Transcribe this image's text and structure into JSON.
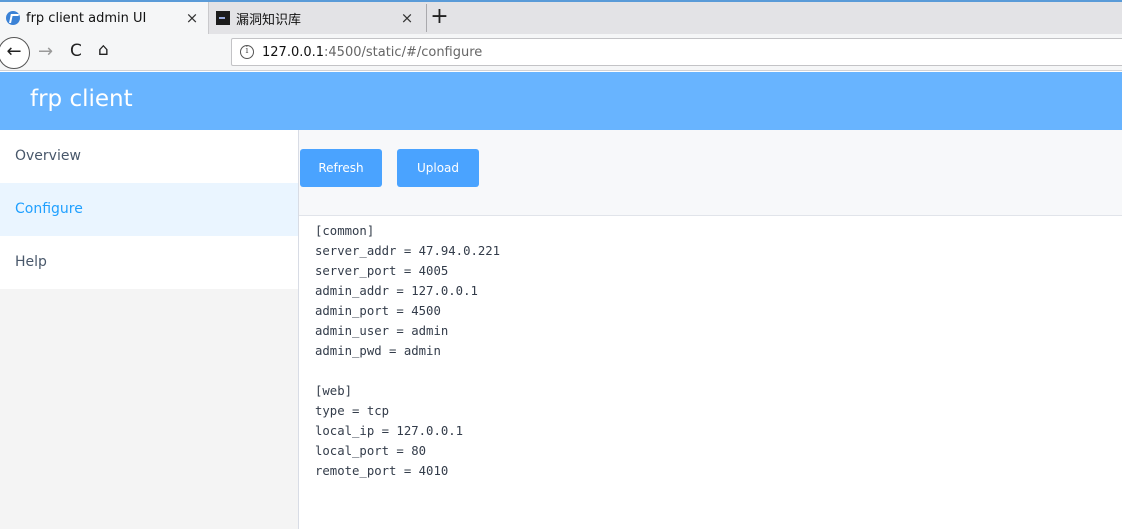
{
  "browser": {
    "tabs": [
      {
        "title": "frp client admin UI",
        "close": "×",
        "icon": "frp-favicon-icon"
      },
      {
        "title": "漏洞知识库",
        "close": "×",
        "icon": "terminal-favicon-icon"
      }
    ],
    "new_tab": "+",
    "nav": {
      "back": "←",
      "forward": "→",
      "reload": "C",
      "home": "⌂"
    },
    "url_host": "127.0.0.1",
    "url_rest": ":4500/static/#/configure",
    "info_glyph": "i"
  },
  "header": {
    "title": "frp client",
    "color": "#68b4ff"
  },
  "sidebar": {
    "items": [
      {
        "label": "Overview",
        "active": false
      },
      {
        "label": "Configure",
        "active": true
      },
      {
        "label": "Help",
        "active": false
      }
    ],
    "active_color": "#20a0ff"
  },
  "toolbar": {
    "refresh_label": "Refresh",
    "upload_label": "Upload",
    "button_color": "#4aa3ff"
  },
  "config": {
    "lines": [
      "[common]",
      "server_addr = 47.94.0.221",
      "server_port = 4005",
      "admin_addr = 127.0.0.1",
      "admin_port = 4500",
      "admin_user = admin",
      "admin_pwd = admin",
      "",
      "[web]",
      "type = tcp",
      "local_ip = 127.0.0.1",
      "local_port = 80",
      "remote_port = 4010"
    ]
  }
}
